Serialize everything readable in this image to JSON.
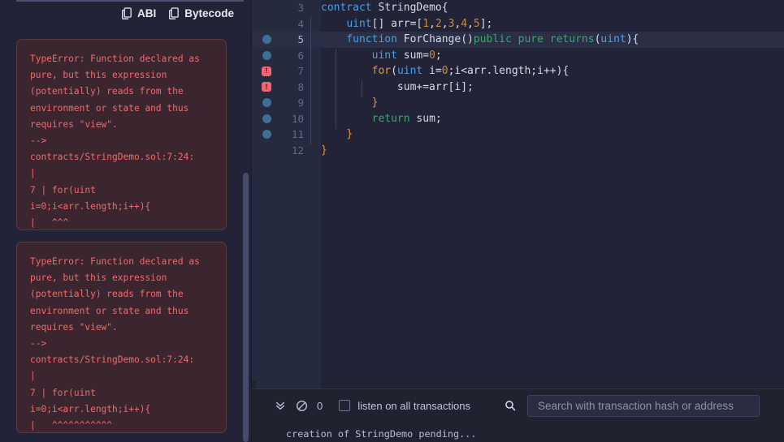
{
  "left_panel": {
    "artifact_buttons": [
      {
        "label": "ABI",
        "icon": "copy-icon"
      },
      {
        "label": "Bytecode",
        "icon": "copy-icon"
      }
    ],
    "error_cards": [
      {
        "text": "TypeError: Function declared as pure, but this expression (potentially) reads from the environment or state and thus requires \"view\".\n--> contracts/StringDemo.sol:7:24:\n|\n7 | for(uint i=0;i<arr.length;i++){\n|   ^^^"
      },
      {
        "text": "TypeError: Function declared as pure, but this expression (potentially) reads from the environment or state and thus requires \"view\".\n--> contracts/StringDemo.sol:7:24:\n|\n7 | for(uint i=0;i<arr.length;i++){\n|   ^^^^^^^^^^^"
      }
    ],
    "colors": {
      "error_bg": "#3b2630",
      "error_border": "#5e3640",
      "error_text": "#f06a6a",
      "panel_bg": "#222336"
    }
  },
  "editor": {
    "filename_lines": [
      {
        "number": "3",
        "marker": "none",
        "indent_guides": 0,
        "active": false,
        "tokens": [
          {
            "t": "contract",
            "c": "t-kw"
          },
          {
            "t": " ",
            "c": "t-plain"
          },
          {
            "t": "StringDemo",
            "c": "t-plain"
          },
          {
            "t": "{",
            "c": "t-plain"
          }
        ]
      },
      {
        "number": "4",
        "marker": "none",
        "indent_guides": 1,
        "active": false,
        "tokens": [
          {
            "t": "    ",
            "c": "t-plain"
          },
          {
            "t": "uint",
            "c": "t-kw"
          },
          {
            "t": "[] ",
            "c": "t-plain"
          },
          {
            "t": "arr=[",
            "c": "t-plain"
          },
          {
            "t": "1",
            "c": "t-num"
          },
          {
            "t": ",",
            "c": "t-plain"
          },
          {
            "t": "2",
            "c": "t-num"
          },
          {
            "t": ",",
            "c": "t-plain"
          },
          {
            "t": "3",
            "c": "t-num"
          },
          {
            "t": ",",
            "c": "t-plain"
          },
          {
            "t": "4",
            "c": "t-num"
          },
          {
            "t": ",",
            "c": "t-plain"
          },
          {
            "t": "5",
            "c": "t-num"
          },
          {
            "t": "];",
            "c": "t-plain"
          }
        ]
      },
      {
        "number": "5",
        "marker": "dot",
        "indent_guides": 1,
        "active": true,
        "tokens": [
          {
            "t": "    ",
            "c": "t-plain"
          },
          {
            "t": "function",
            "c": "t-kw"
          },
          {
            "t": " ForChange()",
            "c": "t-plain"
          },
          {
            "t": "public",
            "c": "t-mod"
          },
          {
            "t": " ",
            "c": "t-plain"
          },
          {
            "t": "pure",
            "c": "t-mod"
          },
          {
            "t": " ",
            "c": "t-plain"
          },
          {
            "t": "returns",
            "c": "t-mod"
          },
          {
            "t": "(",
            "c": "t-plain"
          },
          {
            "t": "uint",
            "c": "t-kw"
          },
          {
            "t": "){",
            "c": "t-plain"
          }
        ]
      },
      {
        "number": "6",
        "marker": "dot",
        "indent_guides": 2,
        "active": false,
        "tokens": [
          {
            "t": "        ",
            "c": "t-plain"
          },
          {
            "t": "uint",
            "c": "t-kw"
          },
          {
            "t": " sum=",
            "c": "t-plain"
          },
          {
            "t": "0",
            "c": "t-num"
          },
          {
            "t": ";",
            "c": "t-plain"
          }
        ]
      },
      {
        "number": "7",
        "marker": "error",
        "indent_guides": 2,
        "active": false,
        "tokens": [
          {
            "t": "        ",
            "c": "t-plain"
          },
          {
            "t": "for",
            "c": "t-kw2"
          },
          {
            "t": "(",
            "c": "t-plain"
          },
          {
            "t": "uint",
            "c": "t-kw"
          },
          {
            "t": " i=",
            "c": "t-plain"
          },
          {
            "t": "0",
            "c": "t-num"
          },
          {
            "t": ";i<arr.length;i++){",
            "c": "t-plain"
          }
        ]
      },
      {
        "number": "8",
        "marker": "error",
        "indent_guides": 3,
        "active": false,
        "tokens": [
          {
            "t": "            ",
            "c": "t-plain"
          },
          {
            "t": "sum+=arr[i];",
            "c": "t-plain"
          }
        ]
      },
      {
        "number": "9",
        "marker": "dot",
        "indent_guides": 2,
        "active": false,
        "tokens": [
          {
            "t": "        ",
            "c": "t-plain"
          },
          {
            "t": "}",
            "c": "t-brace"
          }
        ]
      },
      {
        "number": "10",
        "marker": "dot",
        "indent_guides": 2,
        "active": false,
        "tokens": [
          {
            "t": "        ",
            "c": "t-plain"
          },
          {
            "t": "return",
            "c": "t-mod"
          },
          {
            "t": " sum;",
            "c": "t-plain"
          }
        ]
      },
      {
        "number": "11",
        "marker": "dot",
        "indent_guides": 1,
        "active": false,
        "tokens": [
          {
            "t": "    ",
            "c": "t-plain"
          },
          {
            "t": "}",
            "c": "t-brace"
          }
        ]
      },
      {
        "number": "12",
        "marker": "none",
        "indent_guides": 0,
        "active": false,
        "tokens": [
          {
            "t": "}",
            "c": "t-brace"
          }
        ]
      }
    ],
    "error_marker_glyph": "!",
    "colors": {
      "bg": "#222336",
      "gutter_bg": "#262a3e",
      "active_line_bg": "#2b2f45",
      "breakpoint_dot": "#3e6f96",
      "error_marker": "#f2676d",
      "keyword": "#4a9fe8",
      "modifier": "#3aa76d",
      "control": "#e8913c",
      "number": "#c68b3e",
      "text": "#d7dae7"
    }
  },
  "terminal": {
    "collapse_icon": "chevron-double-down-icon",
    "clear_icon": "ban-icon",
    "pending_count": "0",
    "listen_label": "listen on all transactions",
    "listen_checked": false,
    "search_icon": "search-icon",
    "search_value": "",
    "search_placeholder": "Search with transaction hash or address",
    "log_lines": [
      "creation of StringDemo pending..."
    ]
  }
}
